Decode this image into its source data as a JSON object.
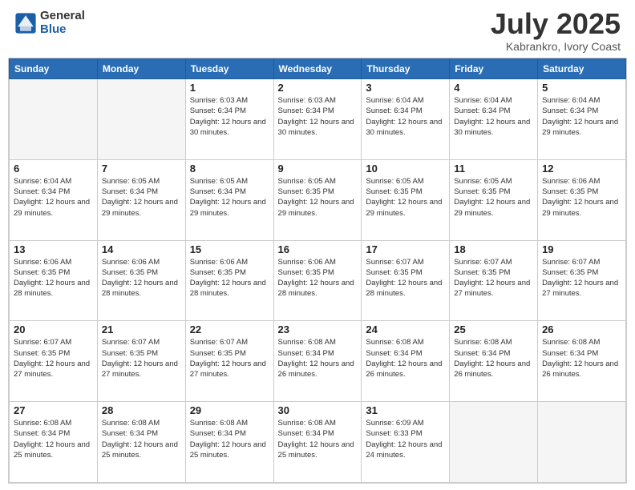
{
  "logo": {
    "general": "General",
    "blue": "Blue"
  },
  "header": {
    "month": "July 2025",
    "location": "Kabrankro, Ivory Coast"
  },
  "days_of_week": [
    "Sunday",
    "Monday",
    "Tuesday",
    "Wednesday",
    "Thursday",
    "Friday",
    "Saturday"
  ],
  "weeks": [
    [
      {
        "day": "",
        "info": ""
      },
      {
        "day": "",
        "info": ""
      },
      {
        "day": "1",
        "info": "Sunrise: 6:03 AM\nSunset: 6:34 PM\nDaylight: 12 hours and 30 minutes."
      },
      {
        "day": "2",
        "info": "Sunrise: 6:03 AM\nSunset: 6:34 PM\nDaylight: 12 hours and 30 minutes."
      },
      {
        "day": "3",
        "info": "Sunrise: 6:04 AM\nSunset: 6:34 PM\nDaylight: 12 hours and 30 minutes."
      },
      {
        "day": "4",
        "info": "Sunrise: 6:04 AM\nSunset: 6:34 PM\nDaylight: 12 hours and 30 minutes."
      },
      {
        "day": "5",
        "info": "Sunrise: 6:04 AM\nSunset: 6:34 PM\nDaylight: 12 hours and 29 minutes."
      }
    ],
    [
      {
        "day": "6",
        "info": "Sunrise: 6:04 AM\nSunset: 6:34 PM\nDaylight: 12 hours and 29 minutes."
      },
      {
        "day": "7",
        "info": "Sunrise: 6:05 AM\nSunset: 6:34 PM\nDaylight: 12 hours and 29 minutes."
      },
      {
        "day": "8",
        "info": "Sunrise: 6:05 AM\nSunset: 6:34 PM\nDaylight: 12 hours and 29 minutes."
      },
      {
        "day": "9",
        "info": "Sunrise: 6:05 AM\nSunset: 6:35 PM\nDaylight: 12 hours and 29 minutes."
      },
      {
        "day": "10",
        "info": "Sunrise: 6:05 AM\nSunset: 6:35 PM\nDaylight: 12 hours and 29 minutes."
      },
      {
        "day": "11",
        "info": "Sunrise: 6:05 AM\nSunset: 6:35 PM\nDaylight: 12 hours and 29 minutes."
      },
      {
        "day": "12",
        "info": "Sunrise: 6:06 AM\nSunset: 6:35 PM\nDaylight: 12 hours and 29 minutes."
      }
    ],
    [
      {
        "day": "13",
        "info": "Sunrise: 6:06 AM\nSunset: 6:35 PM\nDaylight: 12 hours and 28 minutes."
      },
      {
        "day": "14",
        "info": "Sunrise: 6:06 AM\nSunset: 6:35 PM\nDaylight: 12 hours and 28 minutes."
      },
      {
        "day": "15",
        "info": "Sunrise: 6:06 AM\nSunset: 6:35 PM\nDaylight: 12 hours and 28 minutes."
      },
      {
        "day": "16",
        "info": "Sunrise: 6:06 AM\nSunset: 6:35 PM\nDaylight: 12 hours and 28 minutes."
      },
      {
        "day": "17",
        "info": "Sunrise: 6:07 AM\nSunset: 6:35 PM\nDaylight: 12 hours and 28 minutes."
      },
      {
        "day": "18",
        "info": "Sunrise: 6:07 AM\nSunset: 6:35 PM\nDaylight: 12 hours and 27 minutes."
      },
      {
        "day": "19",
        "info": "Sunrise: 6:07 AM\nSunset: 6:35 PM\nDaylight: 12 hours and 27 minutes."
      }
    ],
    [
      {
        "day": "20",
        "info": "Sunrise: 6:07 AM\nSunset: 6:35 PM\nDaylight: 12 hours and 27 minutes."
      },
      {
        "day": "21",
        "info": "Sunrise: 6:07 AM\nSunset: 6:35 PM\nDaylight: 12 hours and 27 minutes."
      },
      {
        "day": "22",
        "info": "Sunrise: 6:07 AM\nSunset: 6:35 PM\nDaylight: 12 hours and 27 minutes."
      },
      {
        "day": "23",
        "info": "Sunrise: 6:08 AM\nSunset: 6:34 PM\nDaylight: 12 hours and 26 minutes."
      },
      {
        "day": "24",
        "info": "Sunrise: 6:08 AM\nSunset: 6:34 PM\nDaylight: 12 hours and 26 minutes."
      },
      {
        "day": "25",
        "info": "Sunrise: 6:08 AM\nSunset: 6:34 PM\nDaylight: 12 hours and 26 minutes."
      },
      {
        "day": "26",
        "info": "Sunrise: 6:08 AM\nSunset: 6:34 PM\nDaylight: 12 hours and 26 minutes."
      }
    ],
    [
      {
        "day": "27",
        "info": "Sunrise: 6:08 AM\nSunset: 6:34 PM\nDaylight: 12 hours and 25 minutes."
      },
      {
        "day": "28",
        "info": "Sunrise: 6:08 AM\nSunset: 6:34 PM\nDaylight: 12 hours and 25 minutes."
      },
      {
        "day": "29",
        "info": "Sunrise: 6:08 AM\nSunset: 6:34 PM\nDaylight: 12 hours and 25 minutes."
      },
      {
        "day": "30",
        "info": "Sunrise: 6:08 AM\nSunset: 6:34 PM\nDaylight: 12 hours and 25 minutes."
      },
      {
        "day": "31",
        "info": "Sunrise: 6:09 AM\nSunset: 6:33 PM\nDaylight: 12 hours and 24 minutes."
      },
      {
        "day": "",
        "info": ""
      },
      {
        "day": "",
        "info": ""
      }
    ]
  ]
}
